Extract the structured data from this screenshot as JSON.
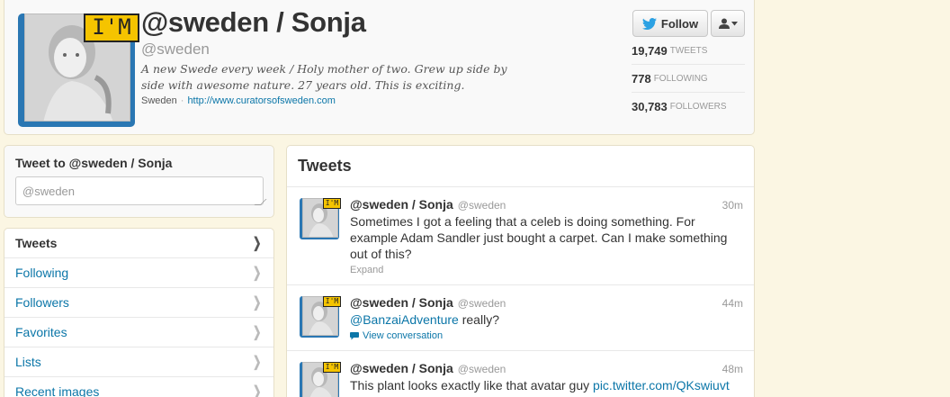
{
  "profile": {
    "name": "@sweden / Sonja",
    "handle": "@sweden",
    "bio": "A new Swede every week / Holy mother of two. Grew up side by side with awesome nature. 27 years old. This is exciting.",
    "location": "Sweden",
    "separator": "·",
    "url": "http://www.curatorsofsweden.com",
    "avatar_badge": "I'M",
    "follow_label": "Follow",
    "stats": [
      {
        "value": "19,749",
        "label": "TWEETS"
      },
      {
        "value": "778",
        "label": "FOLLOWING"
      },
      {
        "value": "30,783",
        "label": "FOLLOWERS"
      }
    ],
    "accent": "#2a77b3",
    "badge_color": "#f5c400"
  },
  "tweet_box": {
    "title": "Tweet to @sweden / Sonja",
    "placeholder": "@sweden"
  },
  "nav": {
    "items": [
      {
        "label": "Tweets",
        "active": true
      },
      {
        "label": "Following"
      },
      {
        "label": "Followers"
      },
      {
        "label": "Favorites"
      },
      {
        "label": "Lists"
      },
      {
        "label": "Recent images"
      }
    ]
  },
  "timeline": {
    "title": "Tweets",
    "tweets": [
      {
        "name": "@sweden / Sonja",
        "handle": "@sweden",
        "time": "30m",
        "text": "Sometimes I got a feeling that a celeb is doing something. For example Adam Sandler just bought a carpet. Can I make something out of this?",
        "footer": "Expand"
      },
      {
        "name": "@sweden / Sonja",
        "handle": "@sweden",
        "time": "44m",
        "mention": "@BanzaiAdventure",
        "text_after": " really?",
        "footer": "View conversation"
      },
      {
        "name": "@sweden / Sonja",
        "handle": "@sweden",
        "time": "48m",
        "text": "This plant looks exactly like that avatar guy ",
        "link": "pic.twitter.com/QKswiuvt"
      }
    ]
  },
  "colors": {
    "link": "#0b76a8",
    "page_bg": "#fbf6e3"
  }
}
